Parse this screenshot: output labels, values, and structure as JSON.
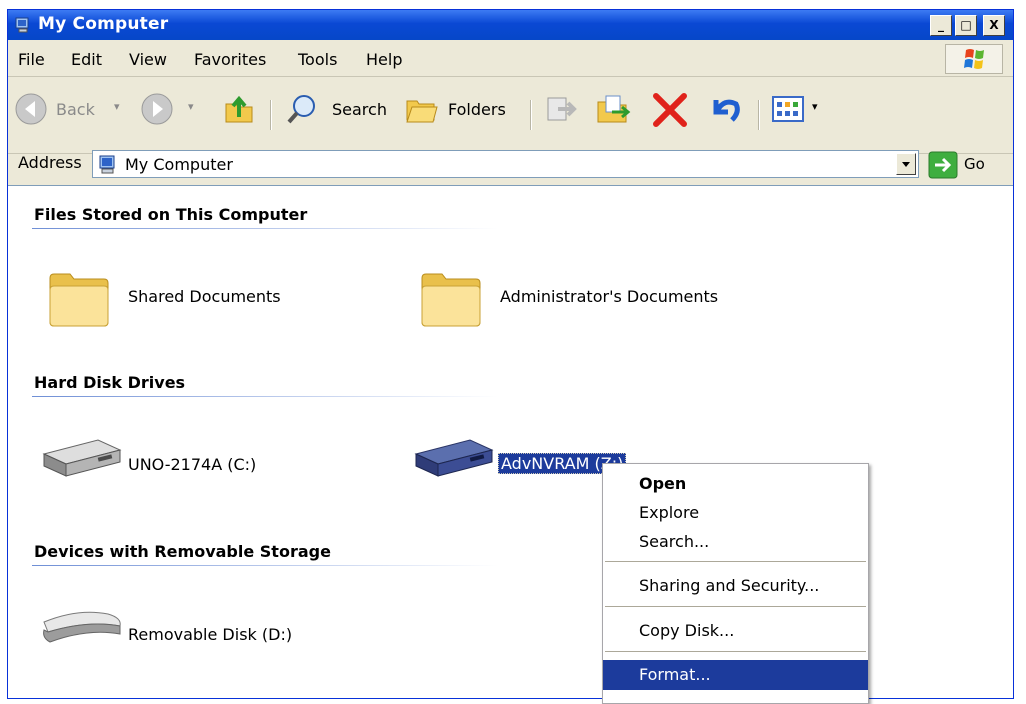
{
  "window": {
    "title": "My Computer"
  },
  "titlebar": {
    "minimize": "_",
    "maximize": "□",
    "close": "X"
  },
  "menu": [
    "File",
    "Edit",
    "View",
    "Favorites",
    "Tools",
    "Help"
  ],
  "toolbar": {
    "back": "Back",
    "search": "Search",
    "folders": "Folders"
  },
  "address": {
    "label": "Address",
    "value": "My Computer",
    "go": "Go"
  },
  "groups": {
    "files": {
      "heading": "Files Stored on This Computer",
      "items": [
        "Shared Documents",
        "Administrator's Documents"
      ]
    },
    "drives": {
      "heading": "Hard Disk Drives",
      "items": [
        "UNO-2174A (C:)",
        "AdvNVRAM (Z:)"
      ]
    },
    "removable": {
      "heading": "Devices with Removable Storage",
      "items": [
        "Removable Disk (D:)"
      ]
    }
  },
  "context_menu": {
    "items": [
      "Open",
      "Explore",
      "Search...",
      "Sharing and Security...",
      "Copy Disk...",
      "Format..."
    ],
    "selected": "Format..."
  },
  "colors": {
    "title_blue": "#0a48d4",
    "selection": "#1c3b9c",
    "chrome": "#ece9d8"
  }
}
